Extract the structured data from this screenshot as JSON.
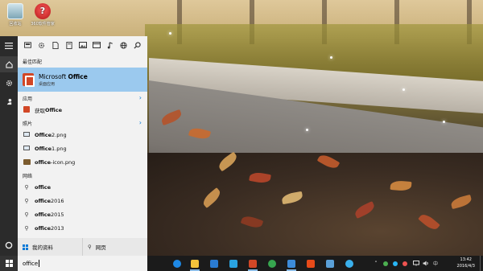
{
  "desktop": {
    "icons": [
      {
        "label": "回收站",
        "icon": "recycle-bin-icon"
      },
      {
        "label": "360软件管家",
        "icon": "software-manager-icon"
      }
    ]
  },
  "start_menu": {
    "left_rail": [
      "hamburger-menu-icon",
      "home-icon",
      "settings-gear-icon",
      "feedback-person-icon",
      "cortana-circle-icon"
    ],
    "filter_icons": [
      "apps-filter-icon",
      "settings-filter-icon",
      "documents-filter-icon",
      "folders-filter-icon",
      "photos-filter-icon",
      "videos-filter-icon",
      "music-filter-icon",
      "web-filter-icon",
      "search-icon"
    ],
    "best_match": {
      "header": "最佳匹配",
      "title_prefix": "Microsoft ",
      "title_bold": "Office",
      "subtitle": "桌面应用"
    },
    "sections": {
      "apps_header": "应用",
      "photos_header": "照片",
      "web_header": "网络"
    },
    "apps": [
      {
        "prefix": "获取 ",
        "bold": "Office"
      }
    ],
    "photos": [
      {
        "bold": "Office",
        "suffix": " 2.png"
      },
      {
        "bold": "Office",
        "suffix": " 1.png"
      },
      {
        "bold": "office",
        "suffix": "-icon.png"
      }
    ],
    "web": [
      {
        "bold": "office",
        "suffix": ""
      },
      {
        "bold": "office",
        "suffix": " 2016"
      },
      {
        "bold": "office",
        "suffix": " 2015"
      },
      {
        "bold": "office",
        "suffix": " 2013"
      }
    ],
    "bottom": {
      "my_stuff": "我的资料",
      "web": "网页"
    }
  },
  "taskbar": {
    "search_query": "office",
    "pinned": [
      {
        "name": "edge",
        "color": "#1e88e5"
      },
      {
        "name": "file-explorer",
        "color": "#f3c33b"
      },
      {
        "name": "store",
        "color": "#2a7bd2"
      },
      {
        "name": "mail",
        "color": "#2aa3e0"
      },
      {
        "name": "word",
        "color": "#d24726"
      },
      {
        "name": "360-browser",
        "color": "#36a64f"
      },
      {
        "name": "store-2",
        "color": "#3c8bd9"
      },
      {
        "name": "office",
        "color": "#e64a19"
      },
      {
        "name": "photos",
        "color": "#5aa0d8"
      },
      {
        "name": "ie",
        "color": "#3ab0ec"
      }
    ],
    "clock_time": "13:42",
    "clock_date": "2016/4/3"
  },
  "colors": {
    "accent": "#0078d7",
    "best_match_highlight": "#9bc9ee",
    "office_orange": "#d24726"
  }
}
